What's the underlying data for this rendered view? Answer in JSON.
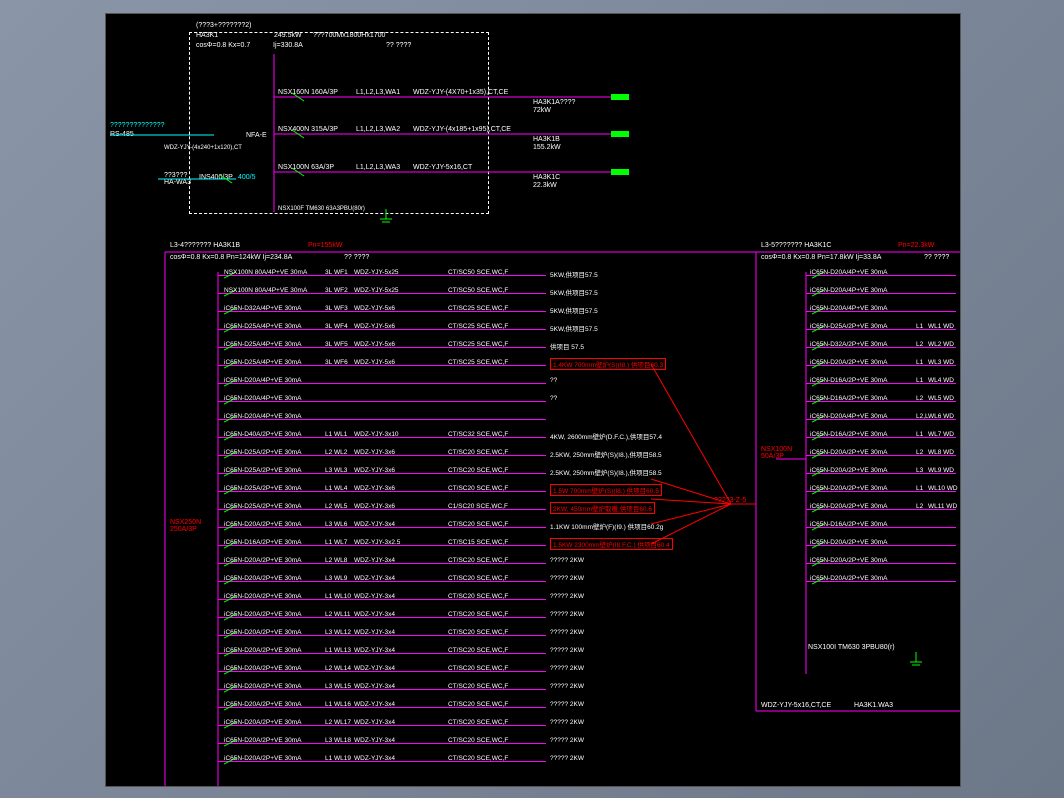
{
  "top": {
    "title": "(???3+???????2)",
    "panel": "HA3K1",
    "params": "cosΦ=0.8  Kx=0.7",
    "power": "249.5kW",
    "current": "Ij=330.8A",
    "cable": "???700Mx1800Hx1700",
    "ref": "?? ????",
    "rs485": "??????????????",
    "rs485_label": "RS-485",
    "bus": "WDZ-YJY-(4x240+1x120),CT",
    "incoming": "INS400/3P",
    "ct": "400/5",
    "meter": "NFA-E",
    "earth": "NSX100F TM630 63A3PBU(80r)",
    "feeders": [
      {
        "breaker": "NSX160N 160A/3P",
        "circuit": "L1,L2,L3,WA1",
        "cable": "WDZ-YJY-(4X70+1x35),CT,CE",
        "tag": "HA3K1A????",
        "load": "72kW"
      },
      {
        "breaker": "NSX400N 315A/3P",
        "circuit": "L1,L2,L3,WA2",
        "cable": "WDZ-YJY-(4x185+1x95),CT,CE",
        "tag": "HA3K1B",
        "load": "155.2kW"
      },
      {
        "breaker": "NSX100N 63A/3P",
        "circuit": "L1,L2,L3,WA3",
        "cable": "WDZ-YJY-5x16,CT",
        "tag": "HA3K1C",
        "load": "22.3kW"
      }
    ],
    "from": "??3???\nHA-WA3"
  },
  "panel_b": {
    "header": "L3-4??????? HA3K1B",
    "pn": "Pn=155kW",
    "params": "cosΦ=0.8 Kx=0.8 Pn=124kW    Ij=234.8A",
    "ref": "?? ????",
    "main_breaker": "NSX250N\n250A/3P",
    "rows": [
      {
        "b": "NSX100N 80A/4P+VE 30mA",
        "c": "3L",
        "w": "WF1",
        "cb": "WDZ-YJY-5x25",
        "ld": "CT/SC50 SCE,WC,F",
        "d": "5KW,供项目57.5"
      },
      {
        "b": "NSX100N 80A/4P+VE 30mA",
        "c": "3L",
        "w": "WF2",
        "cb": "WDZ-YJY-5x25",
        "ld": "CT/SC50 SCE,WC,F",
        "d": "5KW,供项目57.5"
      },
      {
        "b": "iC65N-D32A/4P+VE 30mA",
        "c": "3L",
        "w": "WF3",
        "cb": "WDZ-YJY-5x6",
        "ld": "CT/SC25 SCE,WC,F",
        "d": "5KW,供项目57.5"
      },
      {
        "b": "iC65N-D25A/4P+VE 30mA",
        "c": "3L",
        "w": "WF4",
        "cb": "WDZ-YJY-5x6",
        "ld": "CT/SC25 SCE,WC,F",
        "d": "5KW,供项目57.5"
      },
      {
        "b": "iC65N-D25A/4P+VE 30mA",
        "c": "3L",
        "w": "WF5",
        "cb": "WDZ-YJY-5x6",
        "ld": "CT/SC25 SCE,WC,F",
        "d": "供项目 57.5"
      },
      {
        "b": "iC65N-D25A/4P+VE 30mA",
        "c": "3L",
        "w": "WF6",
        "cb": "WDZ-YJY-5x6",
        "ld": "CT/SC25 SCE,WC,F",
        "d": "1.4KW 700mm壁炉(S)(I8.) 供项目60.3",
        "red": true
      },
      {
        "b": "iC65N-D20A/4P+VE 30mA",
        "c": "",
        "w": "",
        "cb": "",
        "ld": "",
        "d": "??"
      },
      {
        "b": "iC65N-D20A/4P+VE 30mA",
        "c": "",
        "w": "",
        "cb": "",
        "ld": "",
        "d": "??"
      },
      {
        "b": "iC65N-D20A/4P+VE 30mA",
        "c": "",
        "w": "",
        "cb": "",
        "ld": "",
        "d": ""
      },
      {
        "b": "iC65N-D40A/2P+VE 30mA",
        "c": "L1",
        "w": "WL1",
        "cb": "WDZ-YJY-3x10",
        "ld": "CT/SC32 SCE,WC,F",
        "d": "4KW, 2600mm壁炉(D.F.C.),供项目57.4"
      },
      {
        "b": "iC65N-D25A/2P+VE 30mA",
        "c": "L2",
        "w": "WL2",
        "cb": "WDZ-YJY-3x6",
        "ld": "CT/SC20 SCE,WC,F",
        "d": "2.5KW, 250mm壁炉(S)(I8.),供项目58.5"
      },
      {
        "b": "iC65N-D25A/2P+VE 30mA",
        "c": "L3",
        "w": "WL3",
        "cb": "WDZ-YJY-3x6",
        "ld": "CT/SC20 SCE,WC,F",
        "d": "2.5KW, 250mm壁炉(S)(I8.),供项目58.5"
      },
      {
        "b": "iC65N-D25A/2P+VE 30mA",
        "c": "L1",
        "w": "WL4",
        "cb": "WDZ-YJY-3x6",
        "ld": "CT/SC20 SCE,WC,F",
        "d": "1.5W 700mm壁炉(S)(I8.) 供项目60.5",
        "red": true
      },
      {
        "b": "iC65N-D25A/2P+VE 30mA",
        "c": "L2",
        "w": "WL5",
        "cb": "WDZ-YJY-3x6",
        "ld": "C1/SC20 SCE,WC,F",
        "d": "2KW, 450mm壁炉取暖,供项目60.6",
        "red": true
      },
      {
        "b": "iC65N-D20A/2P+VE 30mA",
        "c": "L3",
        "w": "WL6",
        "cb": "WDZ-YJY-3x4",
        "ld": "CT/SC20 SCE,WC,F",
        "d": "1.1KW 100mm壁炉(F)(I9.) 供项目60.2g"
      },
      {
        "b": "iC65N-D16A/2P+VE 30mA",
        "c": "L1",
        "w": "WL7",
        "cb": "WDZ-YJY-3x2.5",
        "ld": "CT/SC15 SCE,WC,F",
        "d": "1.5KW 2300mm壁炉(I8.F.C.) 供项目60.4",
        "red": true
      },
      {
        "b": "iC65N-D20A/2P+VE 30mA",
        "c": "L2",
        "w": "WL8",
        "cb": "WDZ-YJY-3x4",
        "ld": "CT/SC20 SCE,WC,F",
        "d": "????? 2KW"
      },
      {
        "b": "iC65N-D20A/2P+VE 30mA",
        "c": "L3",
        "w": "WL9",
        "cb": "WDZ-YJY-3x4",
        "ld": "CT/SC20 SCE,WC,F",
        "d": "????? 2KW"
      },
      {
        "b": "iC65N-D20A/2P+VE 30mA",
        "c": "L1",
        "w": "WL10",
        "cb": "WDZ-YJY-3x4",
        "ld": "CT/SC20 SCE,WC,F",
        "d": "????? 2KW"
      },
      {
        "b": "iC65N-D20A/2P+VE 30mA",
        "c": "L2",
        "w": "WL11",
        "cb": "WDZ-YJY-3x4",
        "ld": "CT/SC20 SCE,WC,F",
        "d": "????? 2KW"
      },
      {
        "b": "iC65N-D20A/2P+VE 30mA",
        "c": "L3",
        "w": "WL12",
        "cb": "WDZ-YJY-3x4",
        "ld": "CT/SC20 SCE,WC,F",
        "d": "????? 2KW"
      },
      {
        "b": "iC65N-D20A/2P+VE 30mA",
        "c": "L1",
        "w": "WL13",
        "cb": "WDZ-YJY-3x4",
        "ld": "CT/SC20 SCE,WC,F",
        "d": "????? 2KW"
      },
      {
        "b": "iC65N-D20A/2P+VE 30mA",
        "c": "L2",
        "w": "WL14",
        "cb": "WDZ-YJY-3x4",
        "ld": "CT/SC20 SCE,WC,F",
        "d": "????? 2KW"
      },
      {
        "b": "iC65N-D20A/2P+VE 30mA",
        "c": "L3",
        "w": "WL15",
        "cb": "WDZ-YJY-3x4",
        "ld": "CT/SC20 SCE,WC,F",
        "d": "????? 2KW"
      },
      {
        "b": "iC65N-D20A/2P+VE 30mA",
        "c": "L1",
        "w": "WL16",
        "cb": "WDZ-YJY-3x4",
        "ld": "CT/SC20 SCE,WC,F",
        "d": "????? 2KW"
      },
      {
        "b": "iC65N-D20A/2P+VE 30mA",
        "c": "L2",
        "w": "WL17",
        "cb": "WDZ-YJY-3x4",
        "ld": "CT/SC20 SCE,WC,F",
        "d": "????? 2KW"
      },
      {
        "b": "iC65N-D20A/2P+VE 30mA",
        "c": "L3",
        "w": "WL18",
        "cb": "WDZ-YJY-3x4",
        "ld": "CT/SC20 SCE,WC,F",
        "d": "????? 2KW"
      },
      {
        "b": "iC65N-D20A/2P+VE 30mA",
        "c": "L1",
        "w": "WL19",
        "cb": "WDZ-YJY-3x4",
        "ld": "CT/SC20 SCE,WC,F",
        "d": "????? 2KW"
      }
    ]
  },
  "panel_c": {
    "header": "L3-5??????? HA3K1C",
    "pn": "Pn=22.3kW",
    "params": "cosΦ=0.8 Kx=0.8 Pn=17.8kW    Ij=33.8A",
    "ref": "?? ????",
    "main_breaker": "NSX100N\n50A/3P",
    "earth": "NSX100I TM630 3PBU80(r)",
    "feed": "WDZ-YJY-5x16,CT,CE",
    "source": "HA3K1.WA3",
    "rows": [
      {
        "b": "iC65N-D20A/4P+VE 30mA",
        "c": "",
        "w": ""
      },
      {
        "b": "iC65N-D20A/4P+VE 30mA",
        "c": "",
        "w": ""
      },
      {
        "b": "iC65N-D20A/4P+VE 30mA",
        "c": "",
        "w": ""
      },
      {
        "b": "iC65N-D25A/2P+VE 30mA",
        "c": "L1",
        "w": "WL1  WD"
      },
      {
        "b": "iC65N-D32A/2P+VE 30mA",
        "c": "L2",
        "w": "WL2  WD"
      },
      {
        "b": "iC65N-D20A/2P+VE 30mA",
        "c": "L1",
        "w": "WL3  WD"
      },
      {
        "b": "iC65N-D16A/2P+VE 30mA",
        "c": "L1",
        "w": "WL4  WD"
      },
      {
        "b": "iC65N-D16A/2P+VE 30mA",
        "c": "L2",
        "w": "WL5  WD"
      },
      {
        "b": "iC65N-D20A/4P+VE 30mA",
        "c": "L2,L",
        "w": "WL6  WD"
      },
      {
        "b": "iC65N-D16A/2P+VE 30mA",
        "c": "L1",
        "w": "WL7  WD"
      },
      {
        "b": "iC65N-D20A/2P+VE 30mA",
        "c": "L2",
        "w": "WL8  WD"
      },
      {
        "b": "iC65N-D20A/2P+VE 30mA",
        "c": "L3",
        "w": "WL9  WD"
      },
      {
        "b": "iC65N-D20A/2P+VE 30mA",
        "c": "L1",
        "w": "WL10  WD"
      },
      {
        "b": "iC65N-D20A/2P+VE 30mA",
        "c": "L2",
        "w": "WL11  WD"
      },
      {
        "b": "iC65N-D16A/2P+VE 30mA",
        "c": "",
        "w": ""
      },
      {
        "b": "iC65N-D20A/2P+VE 30mA",
        "c": "",
        "w": ""
      },
      {
        "b": "iC65N-D20A/2P+VE 30mA",
        "c": "",
        "w": ""
      },
      {
        "b": "iC65N-D20A/2P+VE 30mA",
        "c": "",
        "w": ""
      }
    ]
  },
  "link": "????3-Z-5"
}
